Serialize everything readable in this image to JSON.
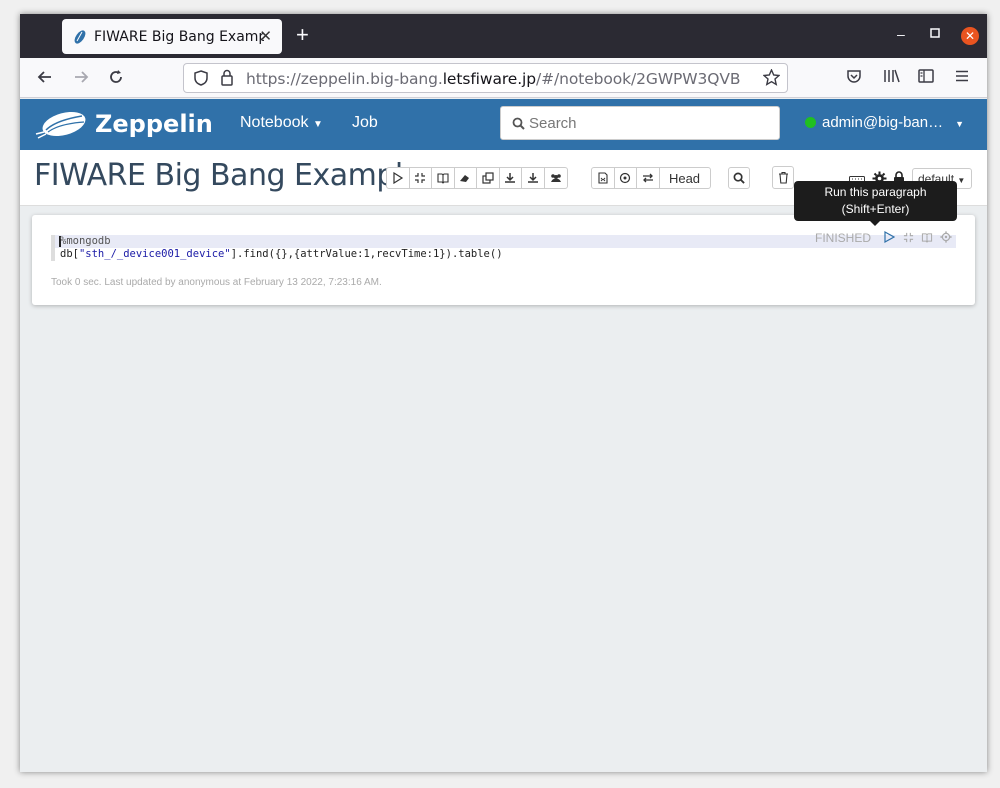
{
  "browser": {
    "tab_title": "FIWARE Big Bang Exampl",
    "tab_close": "✕",
    "new_tab": "+",
    "url_prefix": "https://zeppelin.big-bang.",
    "url_domain": "letsfiware.jp",
    "url_suffix": "/#/notebook/2GWPW3QVB"
  },
  "zeppelin": {
    "logo": "Zeppelin",
    "nav": {
      "notebook": "Notebook",
      "job": "Job"
    },
    "search_placeholder": "Search",
    "user": "admin@big-ban…"
  },
  "notebook": {
    "title": "FIWARE Big Bang Example",
    "head_label": "Head",
    "default_label": "default"
  },
  "paragraph": {
    "line1": "%mongodb",
    "line2_prefix": "db[",
    "line2_string": "\"sth_/_device001_device\"",
    "line2_suffix": "].find({},{attrValue:1,recvTime:1}).table()",
    "status": "FINISHED",
    "footer": "Took 0 sec. Last updated by anonymous at February 13 2022, 7:23:16 AM."
  },
  "tooltip": {
    "line1": "Run this paragraph",
    "line2": "(Shift+Enter)"
  },
  "colors": {
    "header_blue": "#3071a9",
    "title": "#34495e",
    "online_green": "#20c020",
    "close_orange": "#e95420"
  }
}
